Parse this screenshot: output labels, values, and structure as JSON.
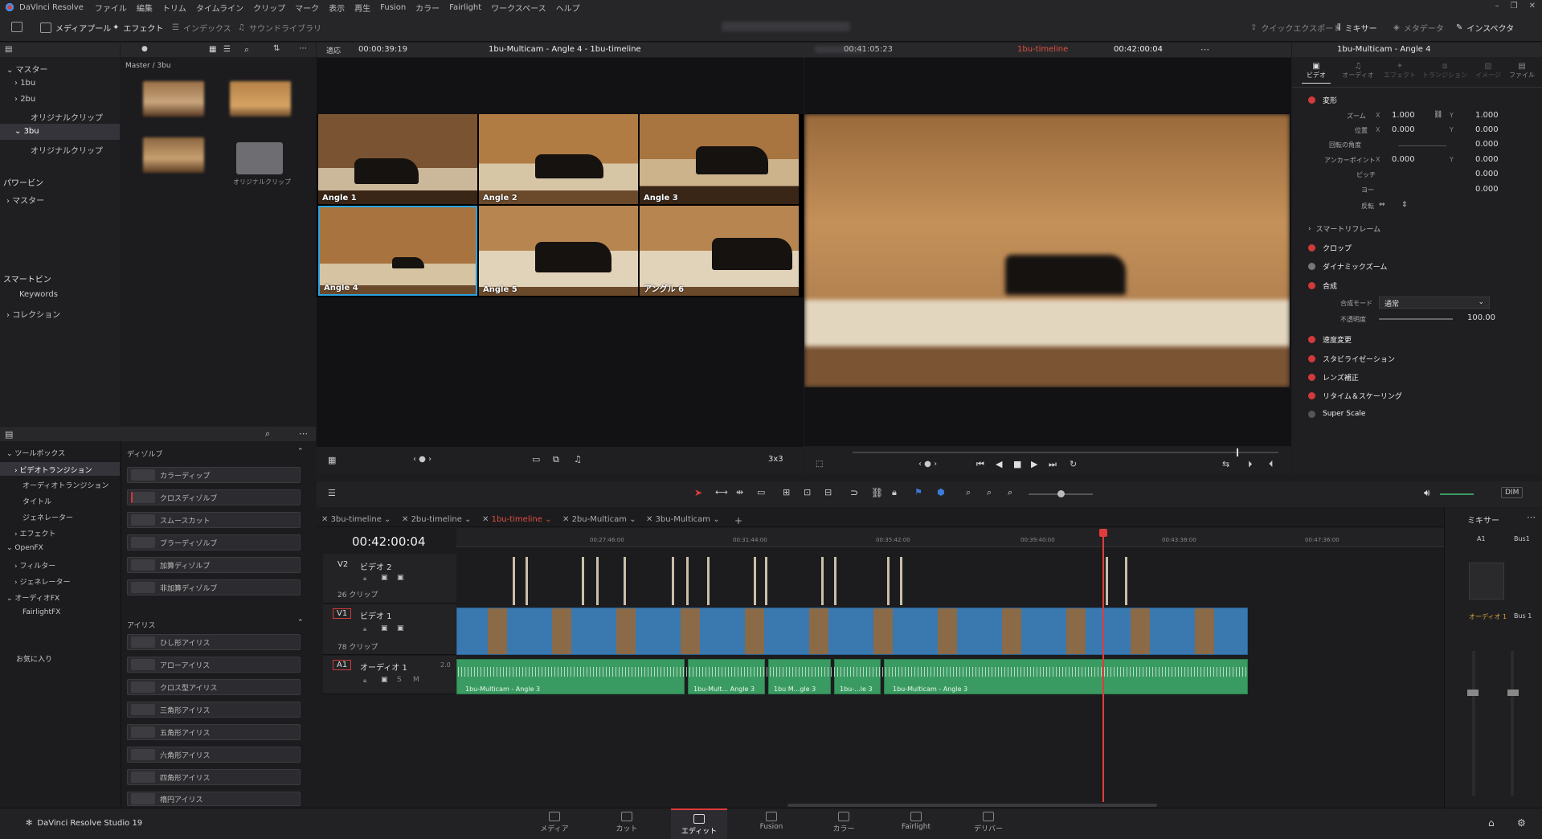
{
  "menu": {
    "app": "DaVinci Resolve",
    "items": [
      "ファイル",
      "編集",
      "トリム",
      "タイムライン",
      "クリップ",
      "マーク",
      "表示",
      "再生",
      "Fusion",
      "カラー",
      "Fairlight",
      "ワークスペース",
      "ヘルプ"
    ]
  },
  "toolbar": {
    "media_pool": "メディアプール",
    "effects": "エフェクト",
    "index": "インデックス",
    "sound_library": "サウンドライブラリ",
    "quick_export": "クイックエクスポート",
    "mixer": "ミキサー",
    "metadata": "メタデータ",
    "inspector": "インスペクタ"
  },
  "viewer_bar": {
    "fit": "適応",
    "source_tc": "00:00:39:19",
    "source_title": "1bu-Multicam - Angle 4 - 1bu-timeline",
    "program_tc_left": "00:41:05:23",
    "timeline_name": "1bu-timeline",
    "program_tc": "00:42:00:04",
    "inspector_title": "1bu-Multicam - Angle 4"
  },
  "media_pool": {
    "path": "Master / 3bu",
    "tree": [
      "マスター",
      "1bu",
      "2bu",
      "オリジナルクリップ",
      "3bu",
      "オリジナルクリップ"
    ],
    "power_bins": "パワービン",
    "power_master": "マスター",
    "smart_bins": "スマートビン",
    "keywords": "Keywords",
    "collection": "コレクション",
    "folder_label": "オリジナルクリップ"
  },
  "toolbox": {
    "items": [
      "ツールボックス",
      "ビデオトランジション",
      "オーディオトランジション",
      "タイトル",
      "ジェネレーター",
      "エフェクト",
      "OpenFX",
      "フィルター",
      "ジェネレーター",
      "オーディオFX",
      "FairlightFX"
    ],
    "favorites": "お気に入り",
    "dissolve_header": "ディゾルブ",
    "dissolves": [
      "カラーディップ",
      "クロスディゾルブ",
      "スムースカット",
      "ブラーディゾルブ",
      "加算ディゾルブ",
      "非加算ディゾルブ"
    ],
    "iris_header": "アイリス",
    "irises": [
      "ひし形アイリス",
      "アローアイリス",
      "クロス型アイリス",
      "三角形アイリス",
      "五角形アイリス",
      "六角形アイリス",
      "四角形アイリス",
      "楕円アイリス"
    ]
  },
  "angles": [
    "Angle 1",
    "Angle 2",
    "Angle 3",
    "Angle 4",
    "Angle 5",
    "アングル 6"
  ],
  "multicam_layout": "3x3",
  "inspector": {
    "tabs": [
      "ビデオ",
      "オーディオ",
      "エフェクト",
      "トランジション",
      "イメージ",
      "ファイル"
    ],
    "transform": "変形",
    "zoom_label": "ズーム",
    "zoom_x": "1.000",
    "zoom_y": "1.000",
    "position_label": "位置",
    "pos_x": "0.000",
    "pos_y": "0.000",
    "rotation_label": "回転の角度",
    "rotation": "0.000",
    "anchor_label": "アンカーポイント",
    "anchor_x": "0.000",
    "anchor_y": "0.000",
    "pitch_label": "ピッチ",
    "pitch": "0.000",
    "yaw_label": "ヨー",
    "yaw": "0.000",
    "flip_label": "反転",
    "smart_reframe": "スマートリフレーム",
    "crop": "クロップ",
    "dynamic_zoom": "ダイナミックズーム",
    "composite": "合成",
    "composite_mode_label": "合成モード",
    "composite_mode": "通常",
    "opacity_label": "不透明度",
    "opacity": "100.00",
    "speed": "速度変更",
    "stabilization": "スタビライゼーション",
    "lens": "レンズ補正",
    "retime": "リタイム＆スケーリング",
    "super_scale": "Super Scale"
  },
  "timeline": {
    "tabs": [
      "3bu-timeline",
      "2bu-timeline",
      "1bu-timeline",
      "2bu-Multicam",
      "3bu-Multicam"
    ],
    "timecode": "00:42:00:04",
    "ruler": [
      "00:27:46:00",
      "00:31:44:00",
      "00:35:42:00",
      "00:39:40:00",
      "00:43:38:00",
      "00:47:36:00"
    ],
    "v2": {
      "id": "V2",
      "name": "ビデオ 2",
      "count": "26 クリップ"
    },
    "v1": {
      "id": "V1",
      "name": "ビデオ 1",
      "count": "78 クリップ"
    },
    "a1": {
      "id": "A1",
      "name": "オーディオ 1",
      "level": "2.0"
    },
    "audio_clips": [
      "1bu-Multicam - Angle 3",
      "1bu-Mult... Angle 3",
      "1bu M...gle 3",
      "1bu-...le 3",
      "1bu-Multicam - Angle 3"
    ],
    "dim": "DIM"
  },
  "mixer": {
    "title": "ミキサー",
    "a1": "A1",
    "bus1": "Bus1",
    "audio1": "オーディオ 1",
    "bus1b": "Bus 1"
  },
  "pages": [
    "メディア",
    "カット",
    "エディット",
    "Fusion",
    "カラー",
    "Fairlight",
    "デリバー"
  ],
  "footer_app": "DaVinci Resolve Studio 19",
  "colors": {
    "accent": "#e03c3c",
    "selection": "#2aa3e0",
    "video_clip": "#3a78b0",
    "audio_clip": "#3a9b62"
  }
}
